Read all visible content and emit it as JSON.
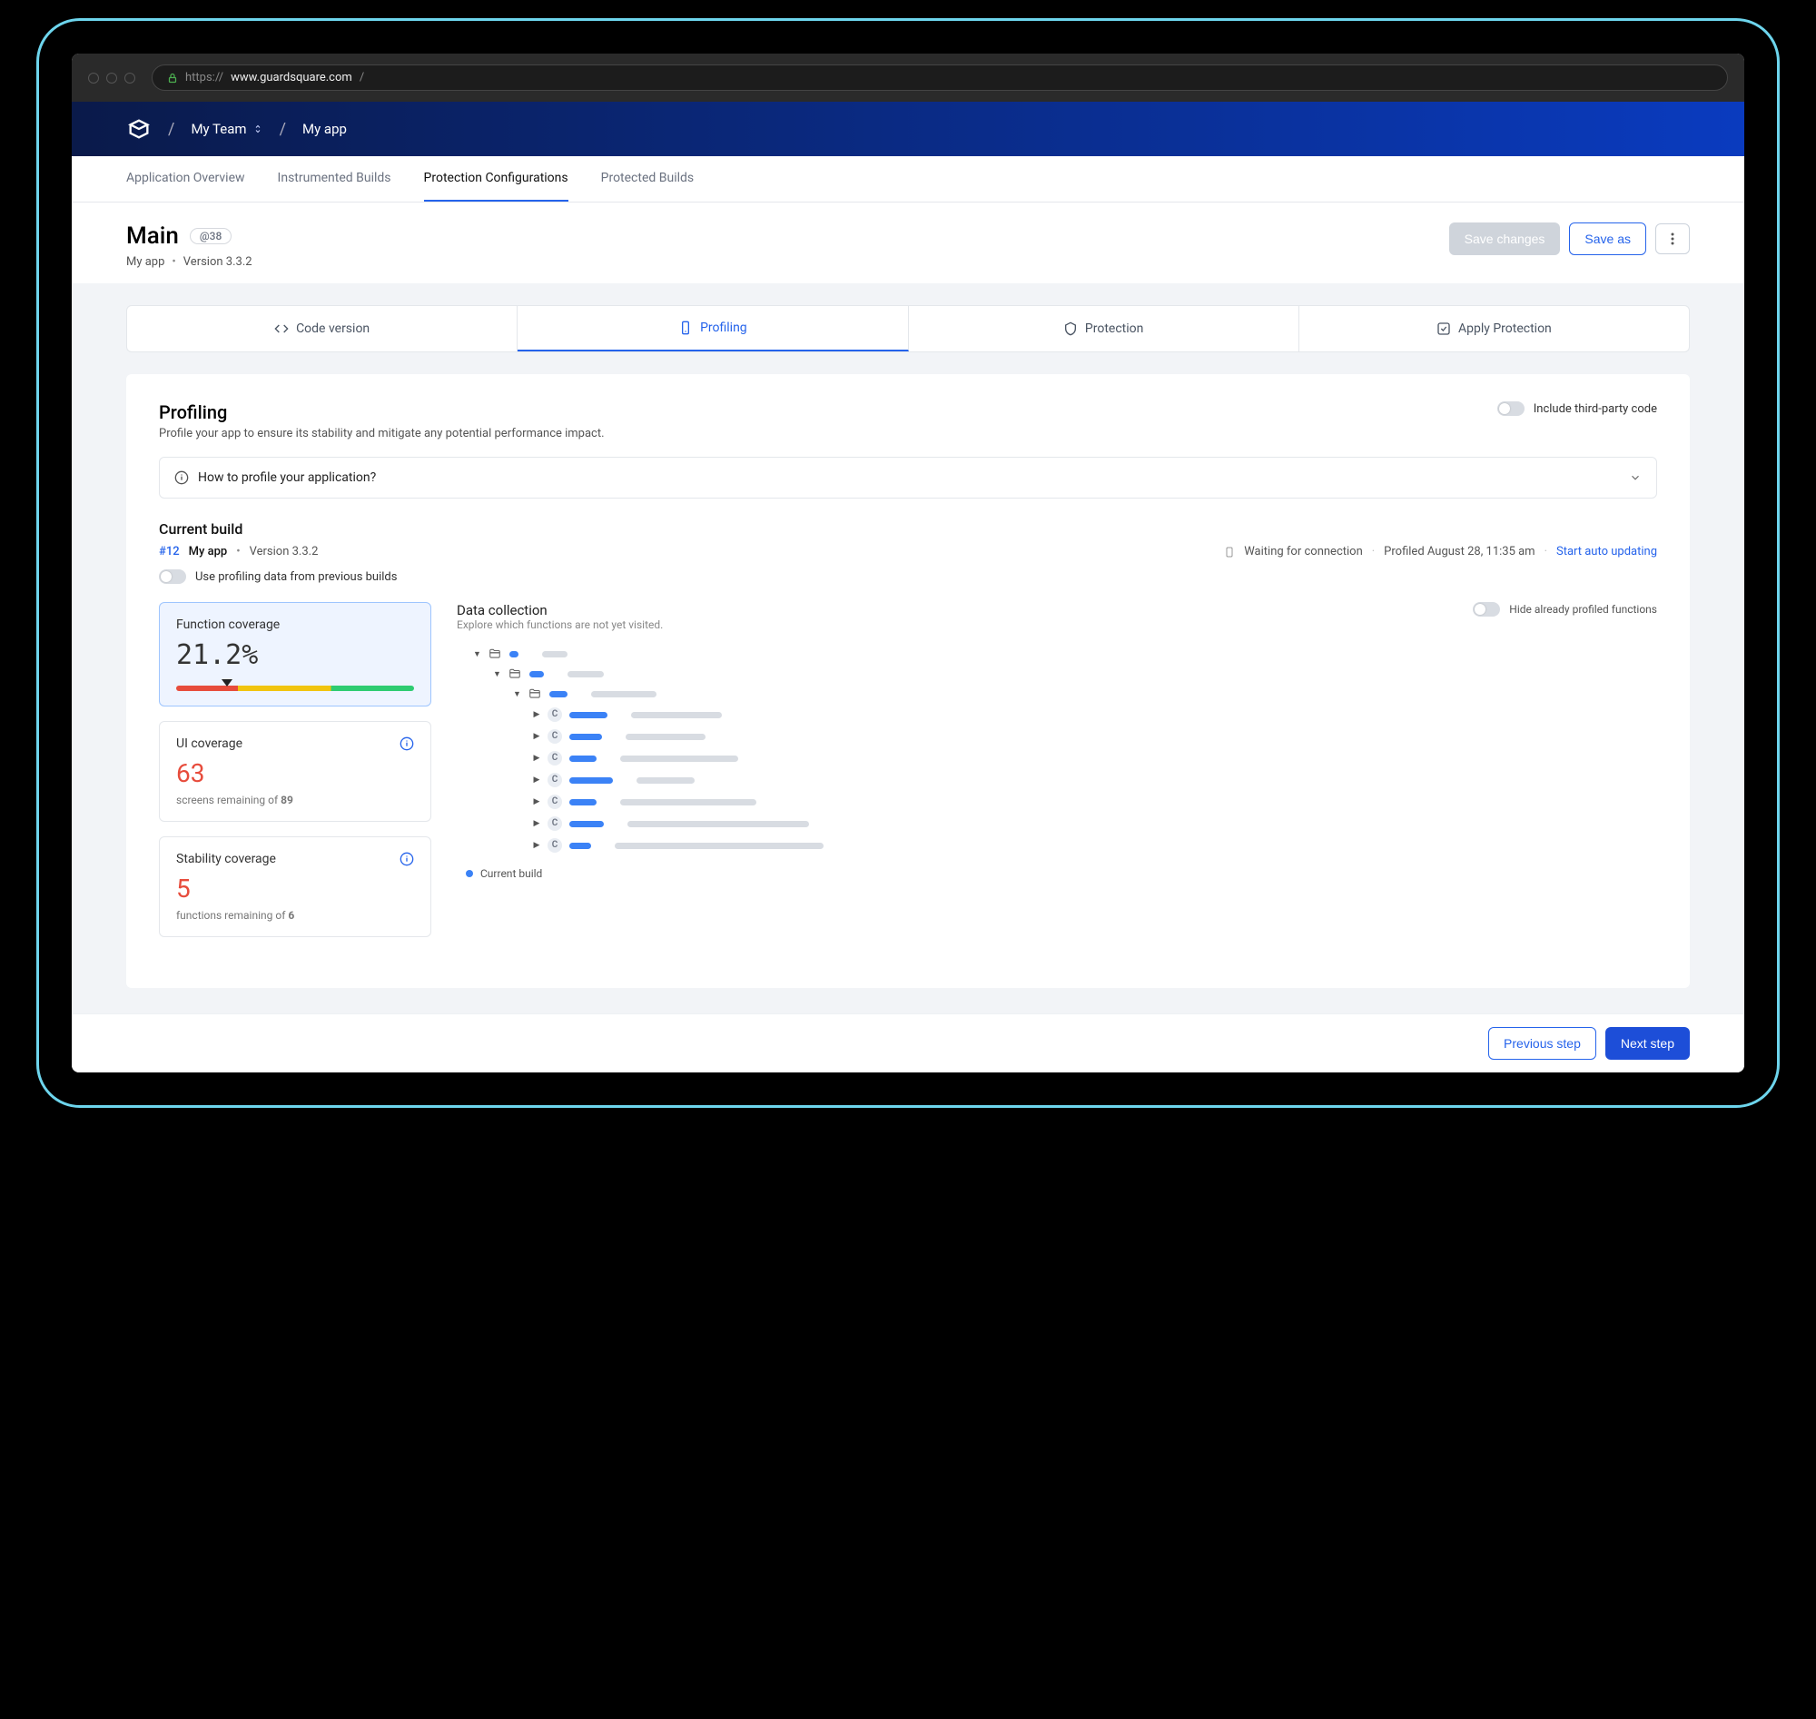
{
  "browser": {
    "url_proto": "https://",
    "url_host": "www.guardsquare.com",
    "url_path": "/"
  },
  "breadcrumb": {
    "team": "My Team",
    "app": "My app"
  },
  "tabs": {
    "overview": "Application Overview",
    "instrumented": "Instrumented Builds",
    "protection_config": "Protection Configurations",
    "protected": "Protected Builds"
  },
  "titlebar": {
    "title": "Main",
    "badge": "@38",
    "app": "My app",
    "version": "Version 3.3.2",
    "save_changes": "Save changes",
    "save_as": "Save as"
  },
  "steps": {
    "code": "Code version",
    "profiling": "Profiling",
    "protection": "Protection",
    "apply": "Apply Protection"
  },
  "panel": {
    "title": "Profiling",
    "sub": "Profile your app to ensure its stability and mitigate any potential performance impact.",
    "toggle_third_party": "Include third-party code",
    "accordion_title": "How to profile your application?"
  },
  "current_build": {
    "heading": "Current build",
    "id": "#12",
    "app": "My app",
    "version": "Version 3.3.2",
    "status": "Waiting for connection",
    "profiled": "Profiled August 28, 11:35 am",
    "auto_update": "Start auto updating",
    "toggle_previous": "Use profiling data from previous builds"
  },
  "cards": {
    "fn_cov_title": "Function coverage",
    "fn_cov_value": "21.2%",
    "ui_cov_title": "UI coverage",
    "ui_cov_value": "63",
    "ui_cov_sub_a": "screens remaining of ",
    "ui_cov_sub_b": "89",
    "stab_title": "Stability coverage",
    "stab_value": "5",
    "stab_sub_a": "functions remaining of ",
    "stab_sub_b": "6"
  },
  "dc": {
    "title": "Data collection",
    "sub": "Explore which functions are not yet visited.",
    "toggle_hide": "Hide already profiled functions",
    "class_label": "C",
    "legend_current": "Current build"
  },
  "tree": [
    {
      "depth": 0,
      "type": "folder",
      "caret": "down",
      "blue": 10,
      "grey": 28
    },
    {
      "depth": 1,
      "type": "folder",
      "caret": "down",
      "blue": 16,
      "grey": 40
    },
    {
      "depth": 2,
      "type": "folder",
      "caret": "down",
      "blue": 20,
      "grey": 72
    },
    {
      "depth": 3,
      "type": "class",
      "caret": "right",
      "blue": 42,
      "grey": 100
    },
    {
      "depth": 3,
      "type": "class",
      "caret": "right",
      "blue": 36,
      "grey": 88
    },
    {
      "depth": 3,
      "type": "class",
      "caret": "right",
      "blue": 30,
      "grey": 130
    },
    {
      "depth": 3,
      "type": "class",
      "caret": "right",
      "blue": 48,
      "grey": 64
    },
    {
      "depth": 3,
      "type": "class",
      "caret": "right",
      "blue": 30,
      "grey": 150
    },
    {
      "depth": 3,
      "type": "class",
      "caret": "right",
      "blue": 38,
      "grey": 200
    },
    {
      "depth": 3,
      "type": "class",
      "caret": "right",
      "blue": 24,
      "grey": 230
    }
  ],
  "footer": {
    "prev": "Previous step",
    "next": "Next step"
  }
}
